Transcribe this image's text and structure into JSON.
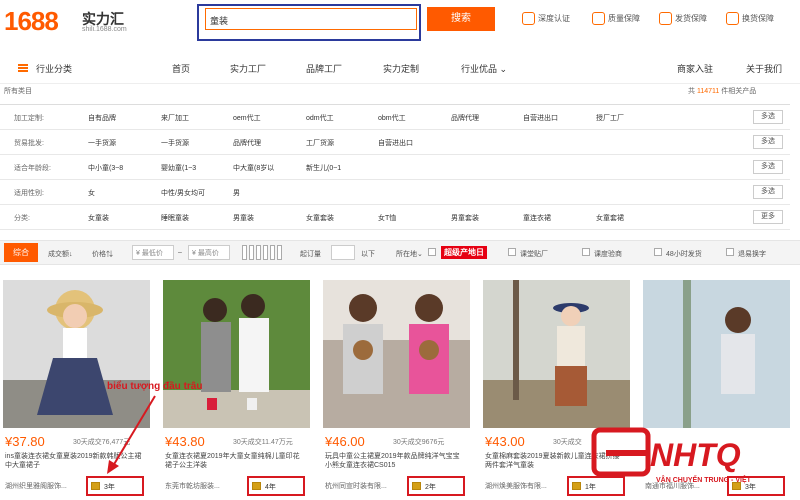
{
  "header": {
    "logo_num": "1688",
    "logo_cn": "实力汇",
    "logo_url": "shili.1688.com",
    "search_value": "童装",
    "search_button": "搜索",
    "services": [
      "深度认证",
      "质量保障",
      "发货保障",
      "换货保障"
    ]
  },
  "nav": {
    "category": "行业分类",
    "items": [
      "首页",
      "实力工厂",
      "品牌工厂",
      "实力定制",
      "行业优品"
    ],
    "right": [
      "商家入驻",
      "关于我们"
    ]
  },
  "breadcrumb": "所有类目",
  "total": {
    "prefix": "共",
    "count": "114711",
    "suffix": "件相关产品"
  },
  "filters": [
    {
      "label": "加工定制:",
      "options": [
        "自有品牌",
        "来厂加工",
        "oem代工",
        "odm代工",
        "obm代工",
        "品牌代理",
        "自营进出口",
        "授厂工厂"
      ],
      "more": "多选"
    },
    {
      "label": "贸易批发:",
      "options": [
        "一手货源",
        "一手货源",
        "品牌代理",
        "工厂货源",
        "自营进出口"
      ],
      "more": "多选"
    },
    {
      "label": "适合年龄段:",
      "options": [
        "中小童(3~8",
        "婴幼童(1~3",
        "中大童(8岁以",
        "新生儿(0~1"
      ],
      "more": "多选"
    },
    {
      "label": "适用性别:",
      "options": [
        "女",
        "中性/男女均可",
        "男"
      ],
      "more": "多选"
    },
    {
      "label": "分类:",
      "options": [
        "女童装",
        "睡眠童装",
        "男童装",
        "女童套装",
        "女T恤",
        "男童套装",
        "童连衣裙",
        "女童套裙"
      ],
      "more": "更多"
    }
  ],
  "sortbar": {
    "active": "综合",
    "sales": "成交额",
    "price": "价格",
    "low": "¥ 最低价",
    "high": "¥ 最高价",
    "order_qty": "起订量",
    "below": "以下",
    "location": "所在地",
    "origin_badge": "超级产地日",
    "checks": [
      "课堂贴厂",
      "课度验商",
      "48小时发货",
      "退易换字"
    ]
  },
  "products": [
    {
      "price": "¥37.80",
      "sold": "30天成交76,477元",
      "title": "ins童装连衣裙女童夏装2019新款韩版公主裙中大童裙子",
      "shop": "湖州织里雅阁服饰...",
      "years": "3年"
    },
    {
      "price": "¥43.80",
      "sold": "30天成交11.47万元",
      "title": "女童连衣裙夏2019年大童女童纯棉儿童印花裙子公主洋装",
      "shop": "东莞市乾坊服装...",
      "years": "4年"
    },
    {
      "price": "¥46.00",
      "sold": "30天成交9676元",
      "title": "玩具中童公主裙夏2019年款品牌纯洋气宝宝小熊女童连衣裙CS015",
      "shop": "杭州同宣时装有限...",
      "years": "2年"
    },
    {
      "price": "¥43.00",
      "sold": "30天成交",
      "title": "女童棉麻套装2019夏装新款儿童连衣裙拼接两件套洋气童装",
      "shop": "湖州焕美服饰有限...",
      "years": "1年"
    },
    {
      "price": "",
      "sold": "",
      "title": "",
      "shop": "南通市福川服饰...",
      "years": "3年"
    }
  ],
  "annotation": "biểu tượng đầu trâu",
  "watermark": {
    "brand": "NHTQ",
    "tagline": "VẬN CHUYỂN TRUNG - VIỆT"
  },
  "colors": {
    "accent": "#ff5a00",
    "highlight": "#d71920",
    "search_outline": "#2b3a9c"
  }
}
